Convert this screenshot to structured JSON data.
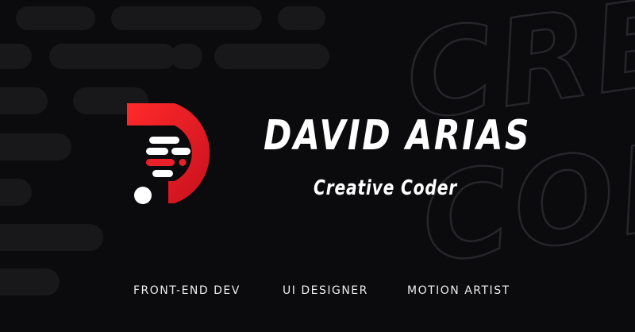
{
  "profile": {
    "name": "DAVID ARIAS",
    "tagline": "Creative Coder"
  },
  "roles": [
    "FRONT-END DEV",
    "UI DESIGNER",
    "MOTION ARTIST"
  ],
  "watermark": {
    "line1": "CRE",
    "line2": "COD"
  },
  "colors": {
    "background": "#0b0b0d",
    "accent": "#e8202a",
    "text": "#ffffff",
    "pill": "#18181b",
    "outline": "#26262a"
  }
}
